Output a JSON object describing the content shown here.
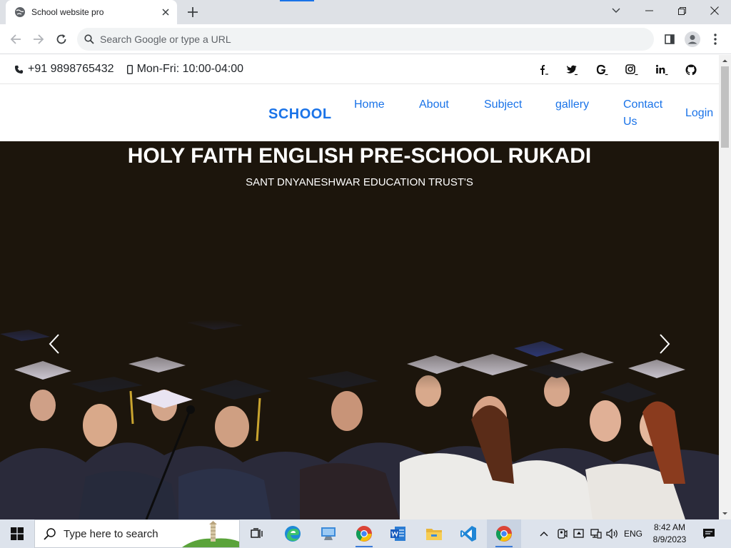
{
  "browser": {
    "tab_title": "School website pro",
    "address_placeholder": "Search Google or type a URL"
  },
  "topbar": {
    "phone": "+91 9898765432",
    "hours": "Mon-Fri: 10:00-04:00",
    "social_icons": [
      "facebook-icon",
      "twitter-icon",
      "google-icon",
      "instagram-icon",
      "linkedin-icon",
      "github-icon"
    ]
  },
  "navbar": {
    "brand": "SCHOOL",
    "links": {
      "home": "Home",
      "about": "About",
      "subject": "Subject",
      "gallery": "gallery",
      "contact_line1": "Contact",
      "contact_line2": "Us",
      "login": "Login"
    }
  },
  "hero": {
    "title": "HOLY FAITH ENGLISH PRE-SCHOOL RUKADI",
    "subtitle": "SANT DNYANESHWAR EDUCATION TRUST'S"
  },
  "taskbar": {
    "search_placeholder": "Type here to search",
    "language": "ENG",
    "time": "8:42 AM",
    "date": "8/9/2023"
  },
  "colors": {
    "link": "#1a73e8",
    "hero_bg": "#1c150c",
    "taskbar_bg": "#dde3ec",
    "tabstrip_bg": "#dee1e6"
  }
}
